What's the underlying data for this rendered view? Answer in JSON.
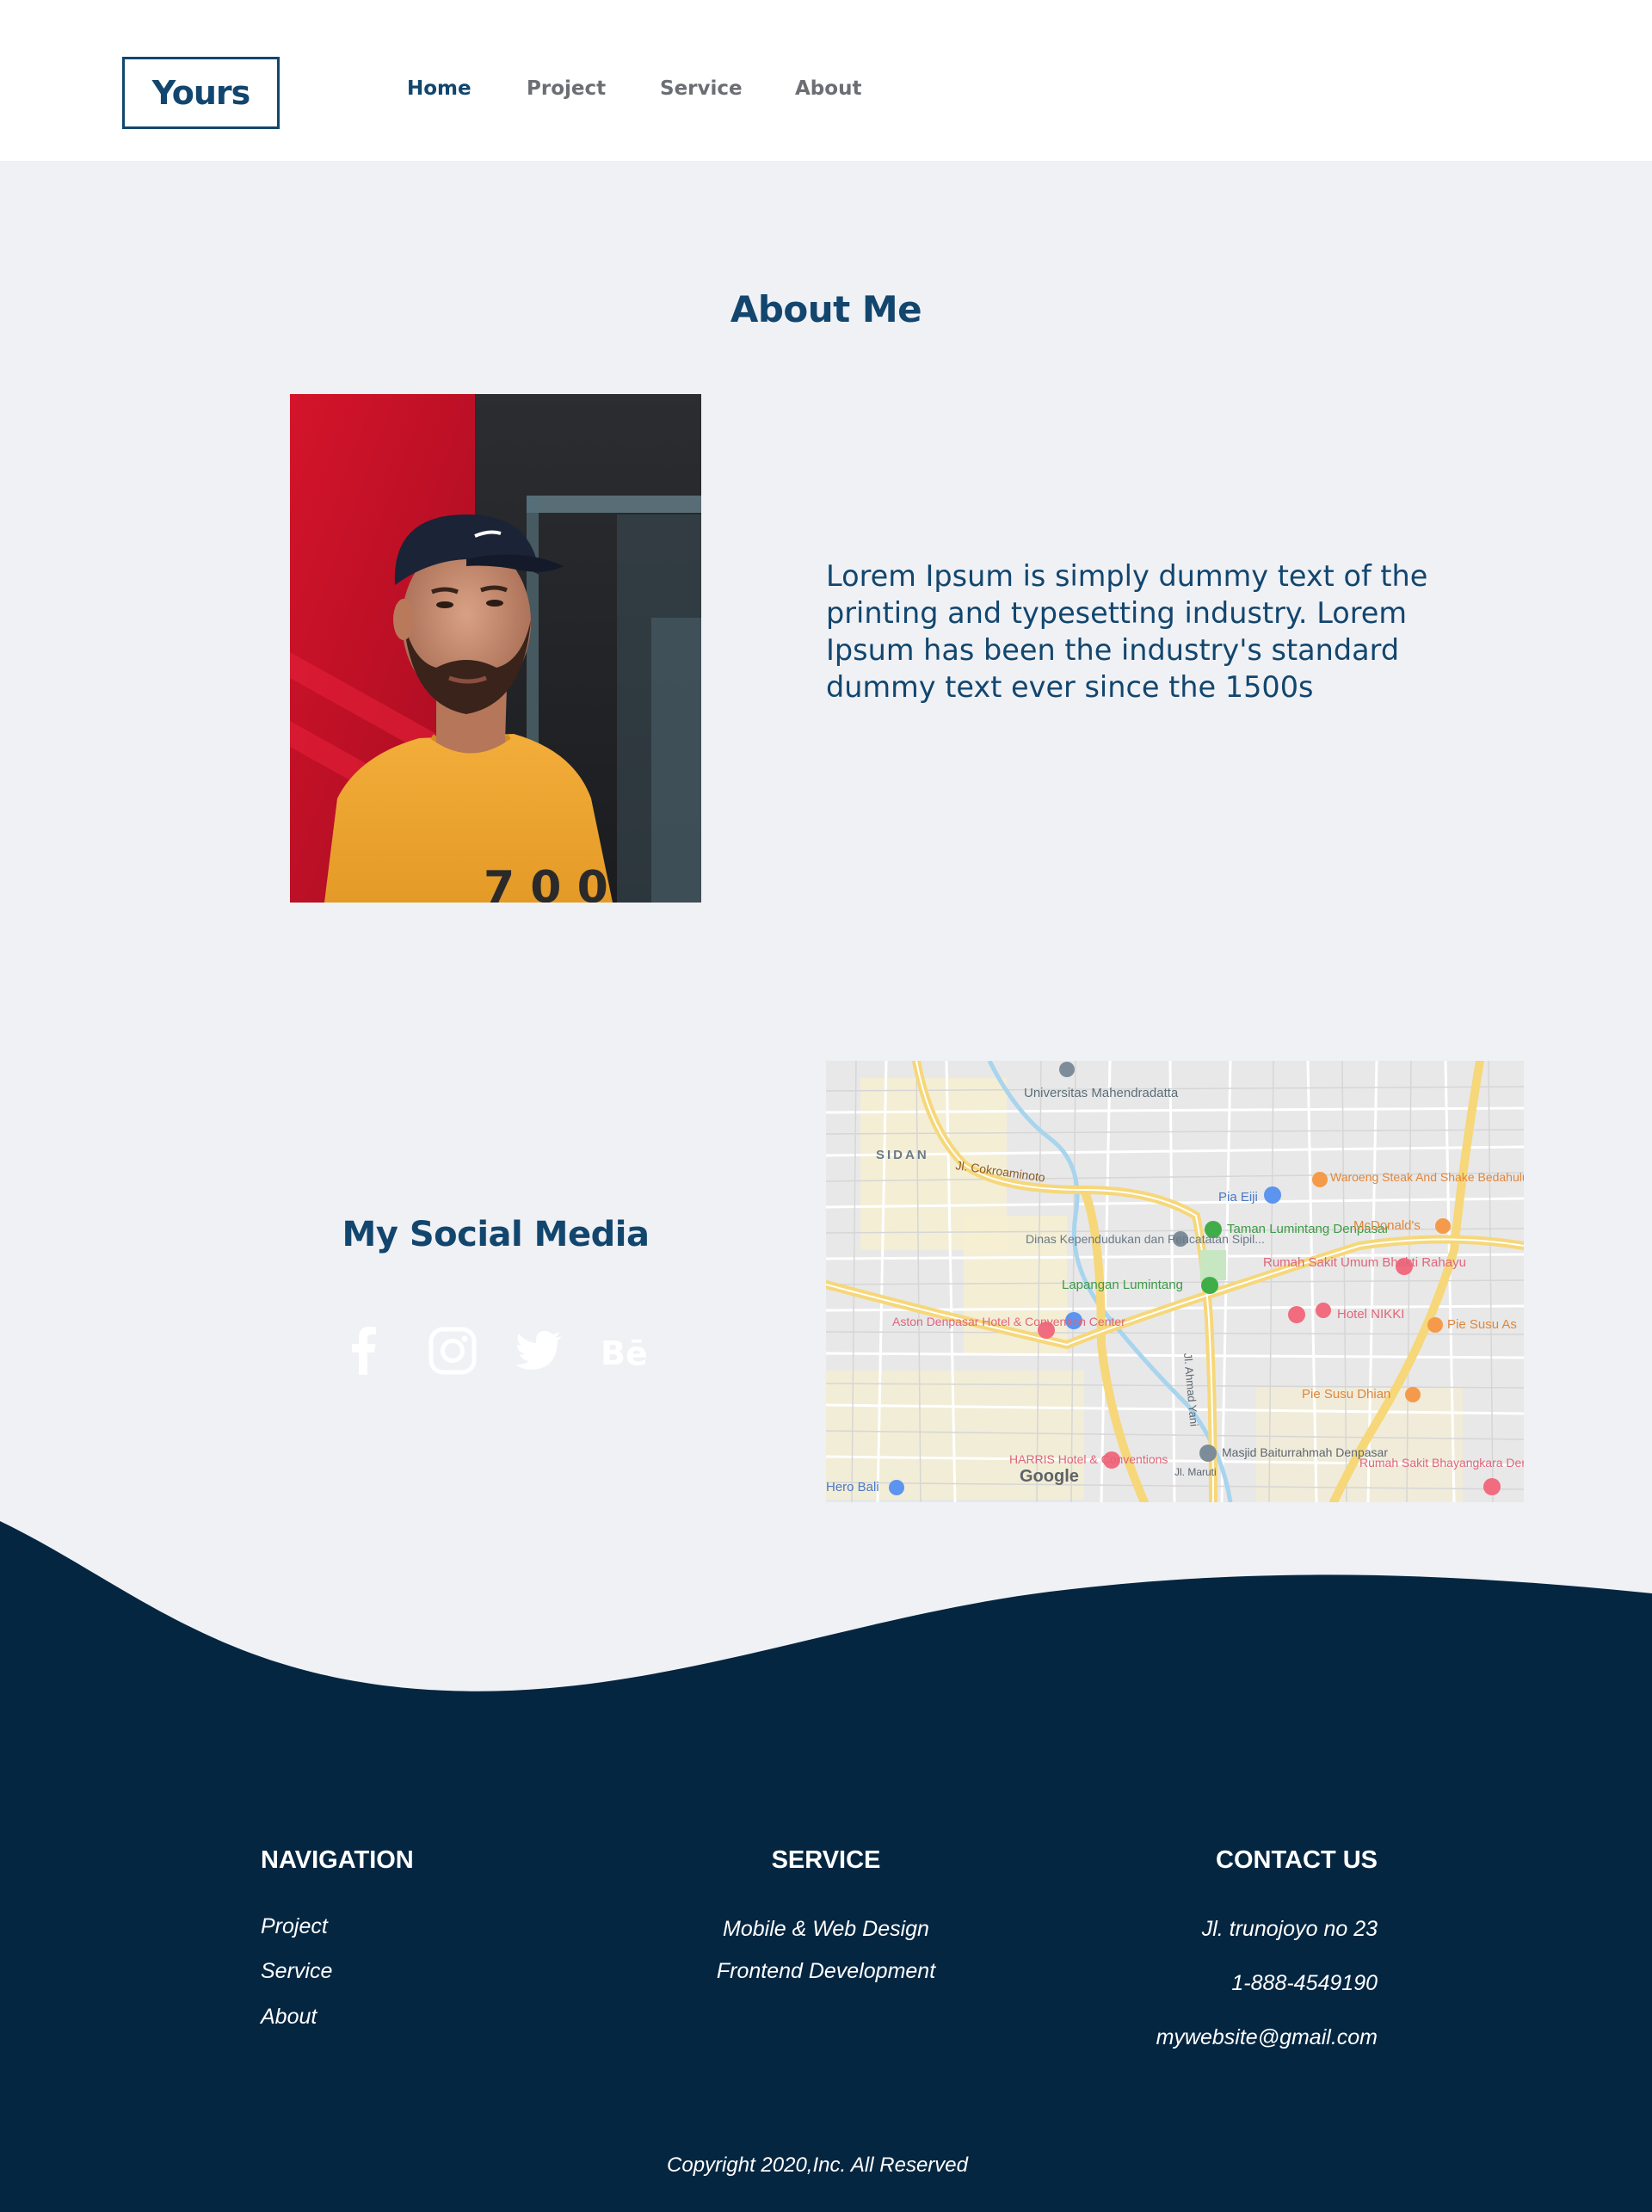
{
  "header": {
    "logo": "Yours",
    "nav": [
      {
        "label": "Home",
        "active": true
      },
      {
        "label": "Project",
        "active": false
      },
      {
        "label": "Service",
        "active": false
      },
      {
        "label": "About",
        "active": false
      }
    ]
  },
  "about": {
    "title": "About Me",
    "photo_alt": "portrait-photo",
    "text": "Lorem Ipsum is simply dummy text of the printing and typesetting industry. Lorem Ipsum has been the industry's standard dummy text ever since the 1500s"
  },
  "social": {
    "title": "My Social Media",
    "icons": [
      "facebook-icon",
      "instagram-icon",
      "twitter-icon",
      "behance-icon"
    ]
  },
  "map": {
    "labels": [
      "Universitas Mahendradatta",
      "SIDAN",
      "Jl. Cokroaminoto",
      "Pia Eiji",
      "Waroeng Steak And Shake Bedahulu Bali",
      "Taman Lumintang Denpasar",
      "McDonald's",
      "Dinas Kependudukan dan Pencatatan Sipil...",
      "Rumah Sakit Umum Bhakti Rahayu",
      "Lapangan Lumintang",
      "Hotel NIKKI",
      "Pie Susu As",
      "Aston Denpasar Hotel & Convention Center",
      "Pie Susu Dhian",
      "Jl. Ahmad Yani",
      "Masjid Baiturrahmah Denpasar",
      "HARRIS Hotel & Conventions",
      "Rumah Sakit Bhayangkara Denpasar",
      "Jl. Maruti",
      "Hero Bali",
      "Google"
    ]
  },
  "footer": {
    "navigation": {
      "title": "NAVIGATION",
      "links": [
        "Project",
        "Service",
        "About"
      ]
    },
    "service": {
      "title": "SERVICE",
      "items": [
        "Mobile & Web Design",
        "Frontend Development"
      ]
    },
    "contact": {
      "title": "CONTACT US",
      "address": "Jl. trunojoyo no 23",
      "phone": "1-888-4549190",
      "email": "mywebsite@gmail.com"
    },
    "copyright": "Copyright 2020,Inc. All Reserved"
  },
  "colors": {
    "brand": "#12466e",
    "page_bg": "#f0f1f5",
    "footer_bg": "#052641",
    "nav_inactive": "#6b6e73"
  }
}
